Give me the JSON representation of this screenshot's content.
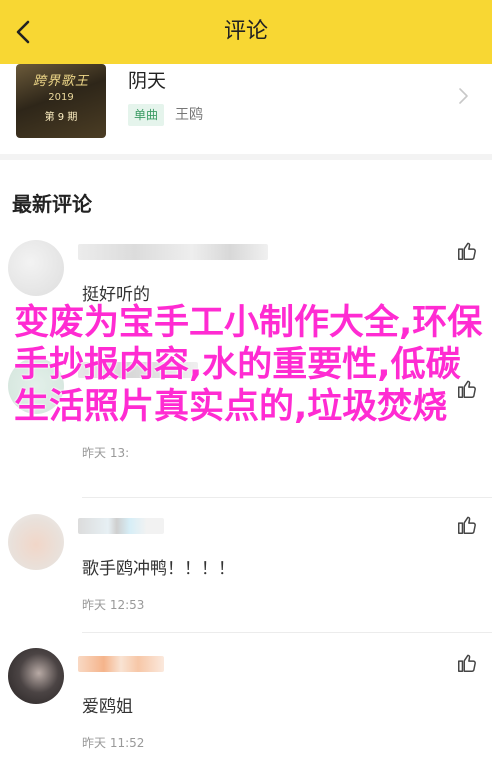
{
  "header": {
    "title": "评论",
    "back_icon": "chevron-left-icon"
  },
  "song": {
    "cover_logo": "跨界歌王",
    "cover_year": "2019",
    "cover_episode": "第 9 期",
    "title": "阴天",
    "tag": "单曲",
    "singer": "王鸥"
  },
  "section_title": "最新评论",
  "comments": [
    {
      "text": "挺好听的",
      "time": ""
    },
    {
      "text": "",
      "time": ""
    },
    {
      "text": "歌手鸥冲鸭！！！！",
      "time": "昨天 12:53"
    },
    {
      "text": "爱鸥姐",
      "time": "昨天 11:52"
    }
  ],
  "comment_ghost_time": "昨天 13:",
  "overlay_text": "变废为宝手工小制作大全,环保手抄报内容,水的重要性,低碳生活照片真实点的,垃圾焚烧",
  "colors": {
    "header": "#f8d733",
    "overlay": "#ff2bd2",
    "tag_bg": "#e5f4ec",
    "tag_text": "#3b9b64"
  }
}
